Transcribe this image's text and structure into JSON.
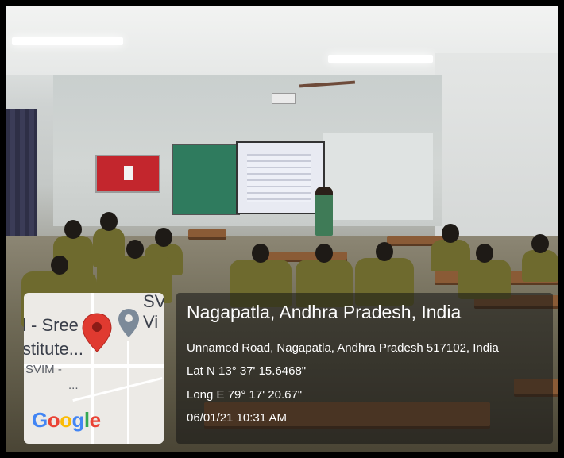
{
  "location": {
    "title": "Nagapatla, Andhra Pradesh, India",
    "address": "Unnamed Road, Nagapatla, Andhra Pradesh 517102, India",
    "latitude": "Lat N 13° 37' 15.6468\"",
    "longitude": "Long E 79° 17' 20.67\"",
    "datetime": "06/01/21 10:31 AM"
  },
  "map": {
    "labels": {
      "sree": "l - Sree",
      "stitute": "stitute...",
      "svim": "SVIM -",
      "svim_dots": "...",
      "sv": "SV",
      "vi": "Vi"
    },
    "brand": {
      "letters": [
        "G",
        "o",
        "o",
        "g",
        "l",
        "e"
      ],
      "colors": [
        "#4285F4",
        "#EA4335",
        "#FBBC05",
        "#4285F4",
        "#34A853",
        "#EA4335"
      ]
    },
    "icons": {
      "red_pin": "map-pin-icon",
      "grey_pin": "location-marker-icon"
    }
  }
}
